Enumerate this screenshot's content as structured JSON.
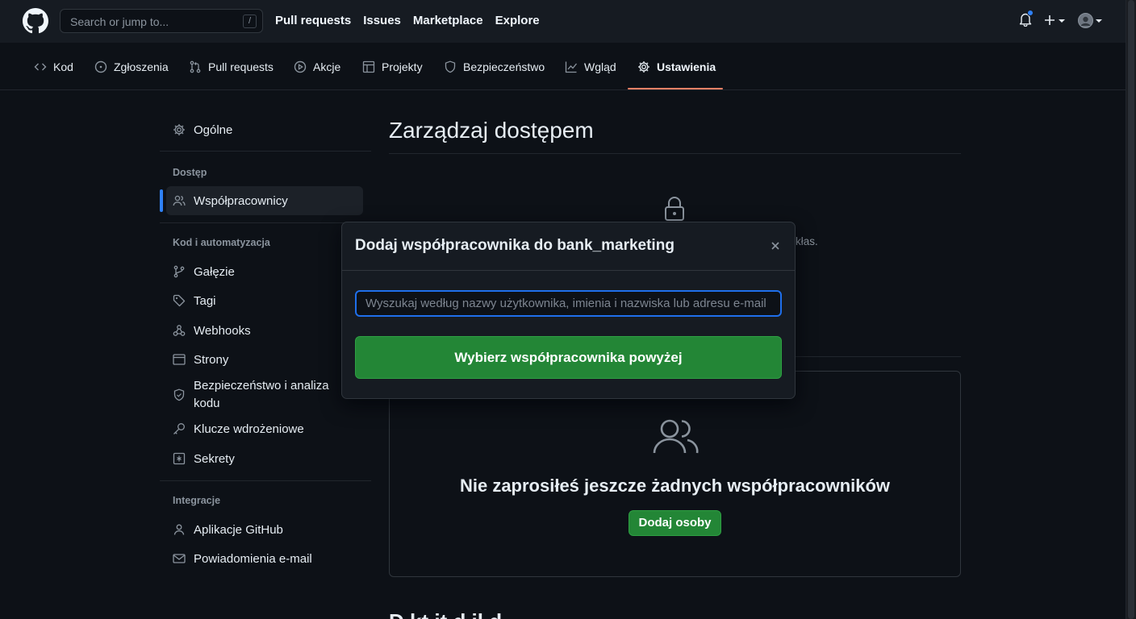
{
  "header": {
    "search_placeholder": "Search or jump to...",
    "search_shortcut": "/",
    "nav": [
      "Pull requests",
      "Issues",
      "Marketplace",
      "Explore"
    ]
  },
  "repo_nav": {
    "items": [
      {
        "label": "Kod",
        "icon": "code-icon"
      },
      {
        "label": "Zgłoszenia",
        "icon": "issue-icon"
      },
      {
        "label": "Pull requests",
        "icon": "pull-request-icon"
      },
      {
        "label": "Akcje",
        "icon": "play-icon"
      },
      {
        "label": "Projekty",
        "icon": "table-icon"
      },
      {
        "label": "Bezpieczeństwo",
        "icon": "shield-icon"
      },
      {
        "label": "Wgląd",
        "icon": "graph-icon"
      },
      {
        "label": "Ustawienia",
        "icon": "gear-icon",
        "active": true
      }
    ]
  },
  "sidebar": {
    "general": "Ogólne",
    "access_heading": "Dostęp",
    "collaborators": "Współpracownicy",
    "code_heading": "Kod i automatyzacja",
    "code_items": [
      "Gałęzie",
      "Tagi",
      "Webhooks",
      "Strony",
      "Bezpieczeństwo i analiza kodu",
      "Klucze wdrożeniowe",
      "Sekrety"
    ],
    "integrations_heading": "Integracje",
    "integrations_items": [
      "Aplikacje GitHub",
      "Powiadomienia e-mail"
    ]
  },
  "main": {
    "title": "Zarządzaj dostępem",
    "hidden_text_fragment": "kłas.",
    "empty_title": "Nie zaprosiłeś jeszcze żadnych współpracowników",
    "add_people": "Dodaj osoby",
    "next_section_peek": "D    kt  it     d il  d"
  },
  "modal": {
    "title": "Dodaj współpracownika do bank_marketing",
    "input_placeholder": "Wyszukaj według nazwy użytkownika, imienia i nazwiska lub adresu e-mail",
    "button": "Wybierz współpracownika powyżej"
  },
  "colors": {
    "background": "#0d1117",
    "header": "#161b22",
    "accent_green": "#238636",
    "accent_blue": "#2f81f7",
    "tab_underline": "#f78166"
  }
}
